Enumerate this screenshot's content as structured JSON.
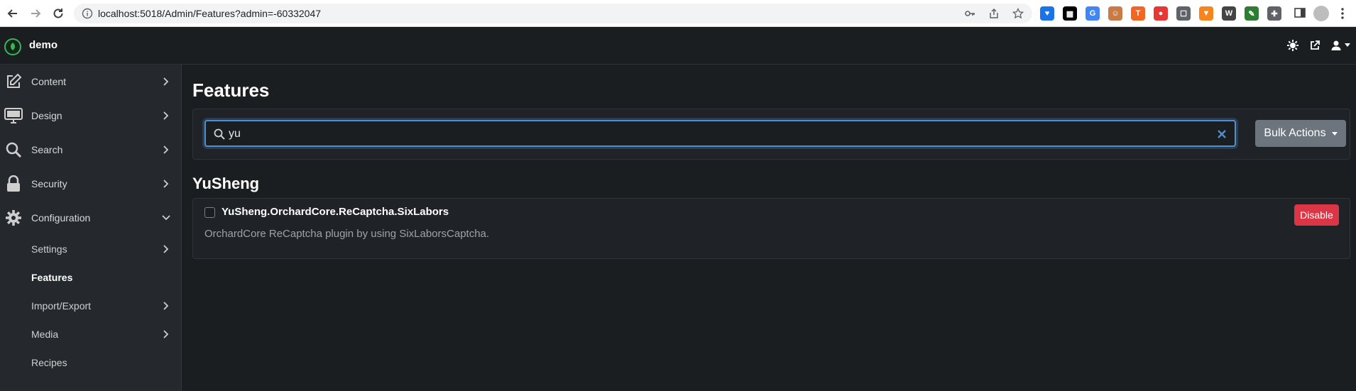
{
  "browser": {
    "url": "localhost:5018/Admin/Features?admin=-60332047",
    "extensions": [
      {
        "name": "heart-ext",
        "color": "#1a73e8",
        "glyph": "♥"
      },
      {
        "name": "calendar-ext",
        "color": "#000000",
        "glyph": "▦"
      },
      {
        "name": "translate-ext",
        "color": "#4285f4",
        "glyph": "G"
      },
      {
        "name": "face-ext",
        "color": "#c97a45",
        "glyph": "☺"
      },
      {
        "name": "orange-ext",
        "color": "#f26522",
        "glyph": "T"
      },
      {
        "name": "red-ext",
        "color": "#e53935",
        "glyph": "●"
      },
      {
        "name": "robot-ext",
        "color": "#5f6368",
        "glyph": "☐"
      },
      {
        "name": "fox-ext",
        "color": "#f6851b",
        "glyph": "▼"
      },
      {
        "name": "w-ext",
        "color": "#444444",
        "glyph": "W"
      },
      {
        "name": "leaf-ext",
        "color": "#2e7d32",
        "glyph": "✎"
      },
      {
        "name": "puzzle-ext",
        "color": "#5f6368",
        "glyph": "✚"
      }
    ]
  },
  "topbar": {
    "brand": "demo"
  },
  "sidebar": {
    "items": [
      {
        "label": "Content",
        "icon": "edit-icon"
      },
      {
        "label": "Design",
        "icon": "monitor-icon"
      },
      {
        "label": "Search",
        "icon": "search-icon"
      },
      {
        "label": "Security",
        "icon": "lock-icon"
      },
      {
        "label": "Configuration",
        "icon": "gear-icon"
      }
    ],
    "subitems": [
      {
        "label": "Settings",
        "chevron": true,
        "active": false
      },
      {
        "label": "Features",
        "chevron": false,
        "active": true
      },
      {
        "label": "Import/Export",
        "chevron": true,
        "active": false
      },
      {
        "label": "Media",
        "chevron": true,
        "active": false
      },
      {
        "label": "Recipes",
        "chevron": false,
        "active": false
      }
    ]
  },
  "main": {
    "title": "Features",
    "search_value": "yu",
    "bulk_actions_label": "Bulk Actions",
    "category_title": "YuSheng",
    "feature": {
      "name": "YuSheng.OrchardCore.ReCaptcha.SixLabors",
      "description": "OrchardCore ReCaptcha plugin by using SixLaborsCaptcha.",
      "action_label": "Disable"
    }
  },
  "colors": {
    "accent": "#4f8fd1",
    "danger": "#dc3545",
    "secondary": "#6c757d",
    "brand_green": "#3fb35a"
  }
}
